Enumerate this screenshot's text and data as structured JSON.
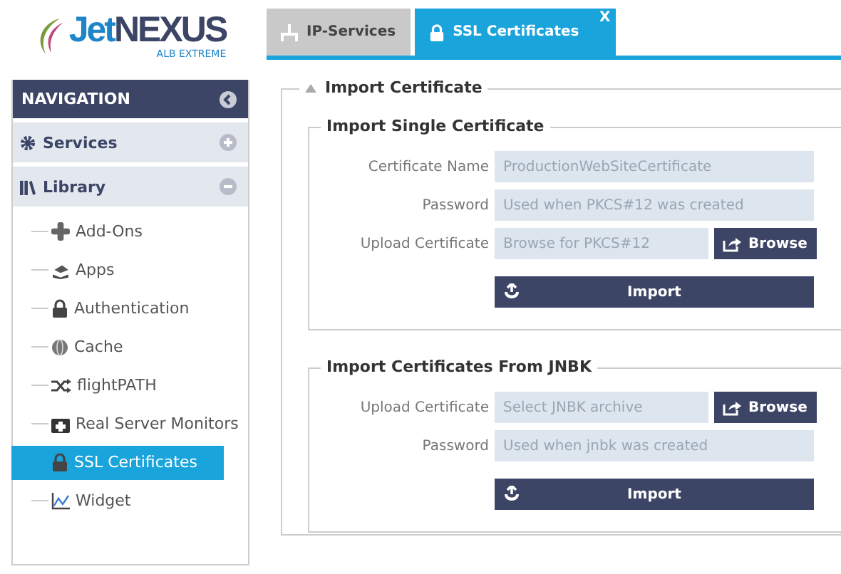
{
  "logo": {
    "prefix": "Jet",
    "main": "NEXUS",
    "tagline": "ALB EXTREME"
  },
  "navigation": {
    "title": "NAVIGATION",
    "sections": [
      {
        "label": "Services",
        "expanded": false
      },
      {
        "label": "Library",
        "expanded": true,
        "children": [
          {
            "label": "Add-Ons",
            "selected": false
          },
          {
            "label": "Apps",
            "selected": false
          },
          {
            "label": "Authentication",
            "selected": false
          },
          {
            "label": "Cache",
            "selected": false
          },
          {
            "label": "flightPATH",
            "selected": false
          },
          {
            "label": "Real Server Monitors",
            "selected": false
          },
          {
            "label": "SSL Certificates",
            "selected": true
          },
          {
            "label": "Widget",
            "selected": false
          }
        ]
      }
    ]
  },
  "tabs": [
    {
      "label": "IP-Services",
      "selected": false
    },
    {
      "label": "SSL Certificates",
      "selected": true,
      "close": "X"
    }
  ],
  "panel": {
    "title": "Import Certificate",
    "expanded": true,
    "groups": [
      {
        "title": "Import Single Certificate",
        "rows": [
          {
            "kind": "text",
            "label": "Certificate Name",
            "placeholder": "ProductionWebSiteCertificate"
          },
          {
            "kind": "text",
            "label": "Password",
            "placeholder": "Used when PKCS#12 was created"
          },
          {
            "kind": "file",
            "label": "Upload Certificate",
            "placeholder": "Browse for PKCS#12",
            "button": "Browse"
          }
        ],
        "action": "Import"
      },
      {
        "title": "Import Certificates From JNBK",
        "rows": [
          {
            "kind": "file",
            "label": "Upload Certificate",
            "placeholder": "Select JNBK archive",
            "button": "Browse"
          },
          {
            "kind": "text",
            "label": "Password",
            "placeholder": "Used when jnbk was created"
          }
        ],
        "action": "Import"
      }
    ]
  }
}
